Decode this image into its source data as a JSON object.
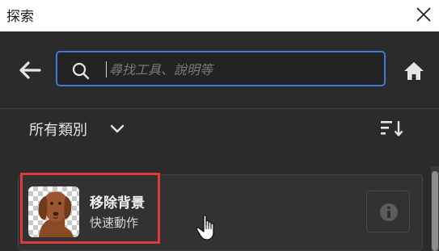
{
  "window": {
    "title": "探索"
  },
  "search": {
    "placeholder": "尋找工具、說明等",
    "value": ""
  },
  "filter": {
    "category_label": "所有類別"
  },
  "result_card": {
    "title": "移除背景",
    "subtitle": "快速動作"
  },
  "icons": {
    "close": "close-icon",
    "back": "arrow-left-icon",
    "search": "search-icon",
    "home": "home-icon",
    "chevron": "chevron-down-icon",
    "sort": "sort-icon",
    "info": "info-icon",
    "cursor": "hand-pointer-cursor-icon"
  },
  "colors": {
    "panel_bg": "#2b2b2b",
    "titlebar_bg": "#ffffff",
    "search_focus_border": "#3c7bd6",
    "highlight_border": "#e0393a",
    "card_bg": "#323232"
  }
}
